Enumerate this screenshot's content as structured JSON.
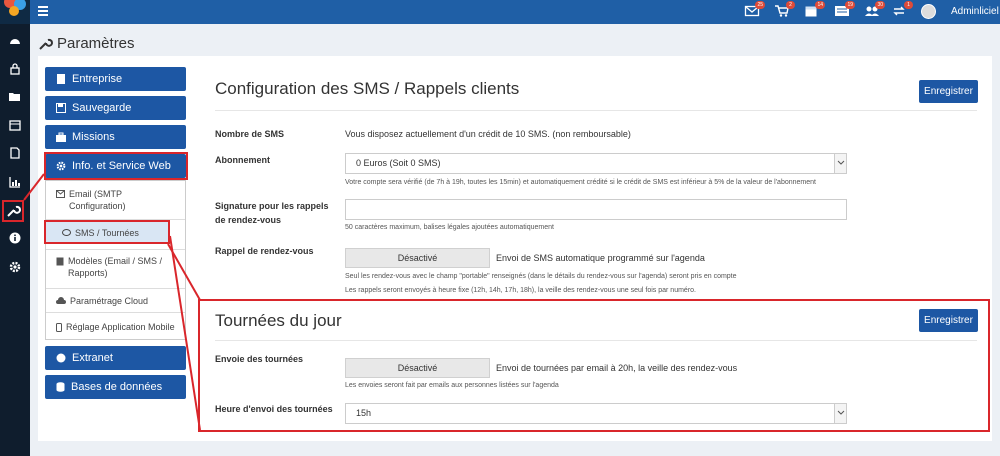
{
  "topbar": {
    "username": "Adminliciel",
    "badges": [
      "25",
      "2",
      "14",
      "19",
      "30",
      "1"
    ]
  },
  "page": {
    "title": "Paramètres"
  },
  "nav": {
    "entreprise": "Entreprise",
    "sauvegarde": "Sauvegarde",
    "missions": "Missions",
    "info": "Info. et Service Web",
    "extranet": "Extranet",
    "bdd": "Bases de données"
  },
  "submenu": {
    "email": "Email (SMTP Configuration)",
    "sms": "SMS / Tournées",
    "modeles": "Modèles (Email / SMS / Rapports)",
    "cloud": "Paramétrage Cloud",
    "mobile": "Réglage Application Mobile"
  },
  "sms": {
    "title": "Configuration des SMS / Rappels clients",
    "save": "Enregistrer",
    "nb_label": "Nombre de SMS",
    "nb_value": "Vous disposez actuellement d'un crédit de 10 SMS. (non remboursable)",
    "abonnement_label": "Abonnement",
    "abonnement_value": "0 Euros (Soit 0 SMS)",
    "abonnement_help": "Votre compte sera vérifié (de 7h à 19h, toutes les 15min) et automatiquement crédité si le crédit de SMS est inférieur à 5% de la valeur de l'abonnement",
    "signature_label": "Signature pour les rappels de rendez-vous",
    "signature_value": "",
    "signature_help": "50 caractères maximum, balises légales ajoutées automatiquement",
    "rappel_label": "Rappel de rendez-vous",
    "rappel_toggle": "Désactivé",
    "rappel_desc": "Envoi de SMS automatique programmé sur l'agenda",
    "rappel_help1": "Seul les rendez-vous avec le champ \"portable\" renseignés (dans le détails du rendez-vous sur l'agenda) seront pris en compte",
    "rappel_help2": "Les rappels seront envoyés à heure fixe (12h, 14h, 17h, 18h), la veille des rendez-vous une seul fois par numéro."
  },
  "tournees": {
    "title": "Tournées du jour",
    "save": "Enregistrer",
    "envoi_label": "Envoie des tournées",
    "envoi_toggle": "Désactivé",
    "envoi_desc": "Envoi de tournées par email à 20h, la veille des rendez-vous",
    "envoi_help": "Les envoies seront fait par emails aux personnes listées sur l'agenda",
    "heure_label": "Heure d'envoi des tournées",
    "heure_value": "15h"
  },
  "colors": {
    "primary": "#1d57a4",
    "topbar": "#1f5fa6",
    "sidebar": "#0f1d2d",
    "highlight": "#d9262b"
  }
}
